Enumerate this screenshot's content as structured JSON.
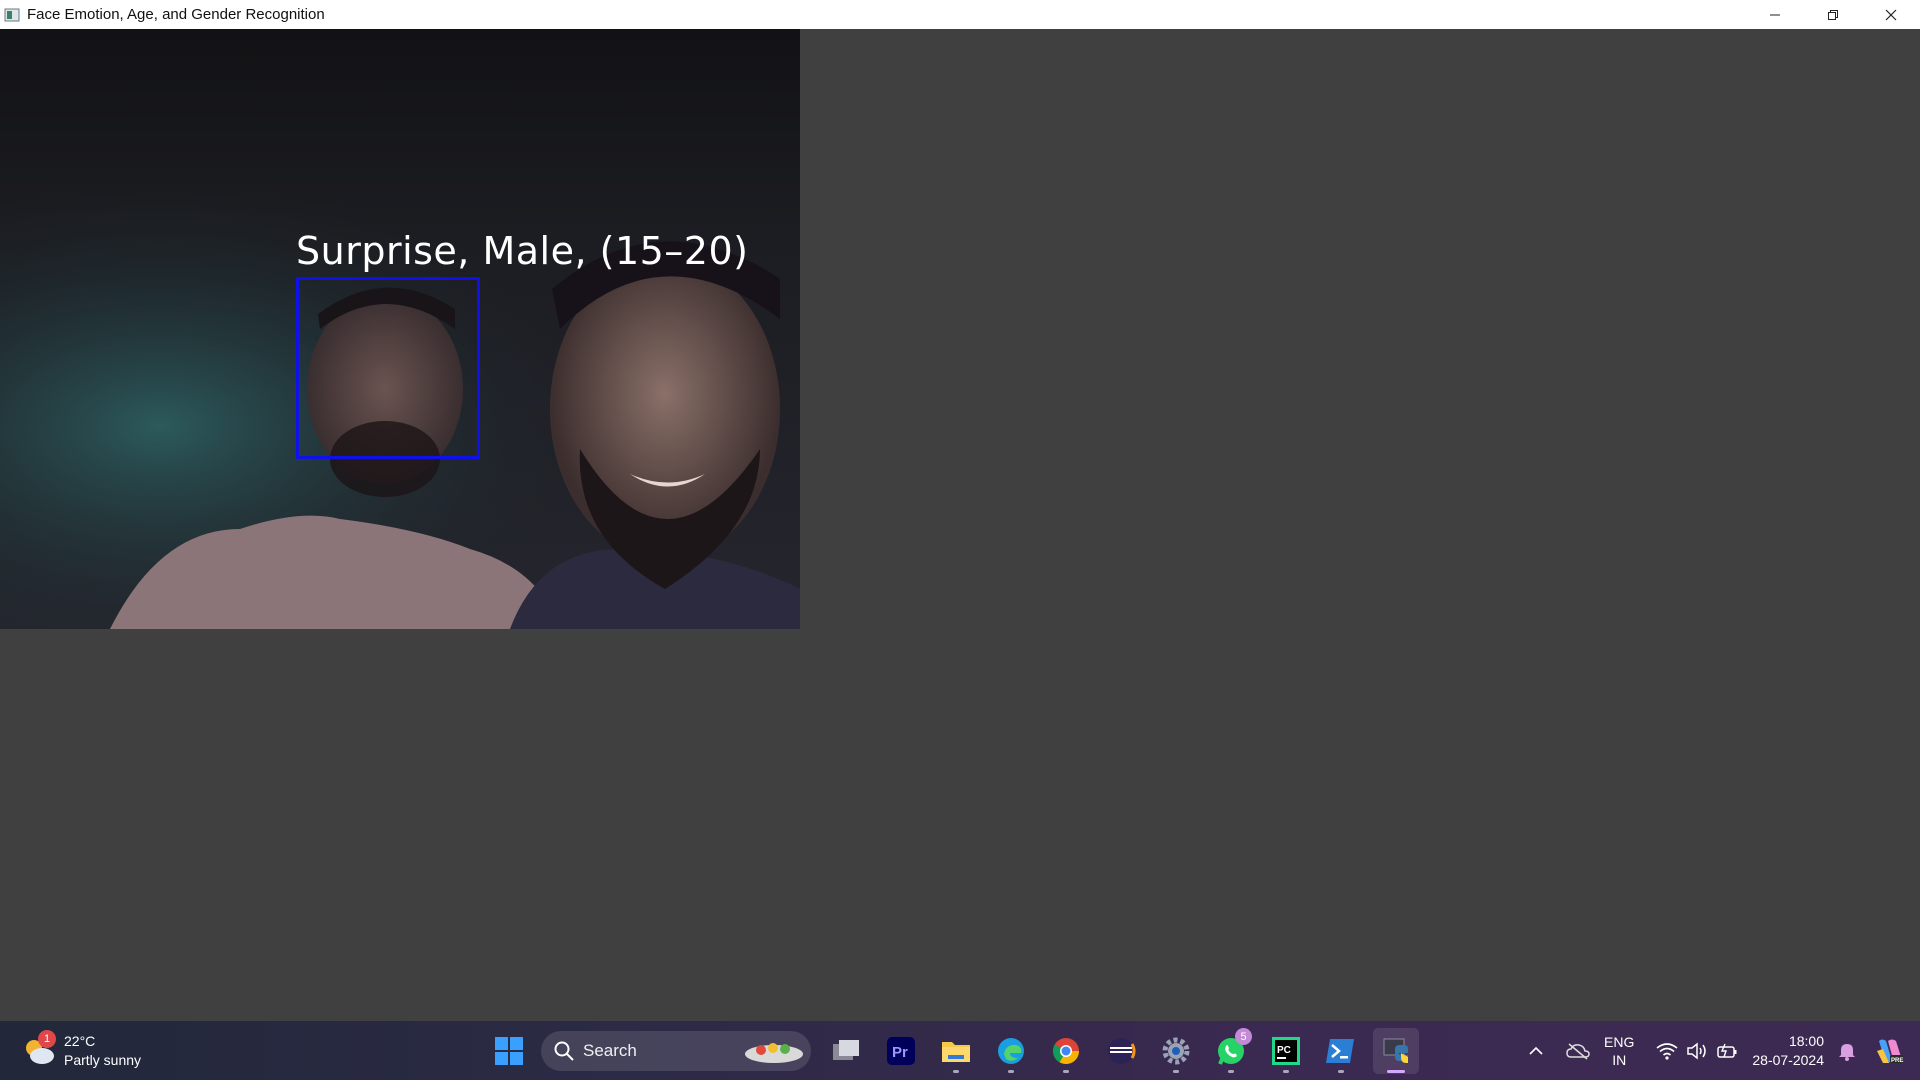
{
  "window": {
    "title": "Face Emotion, Age, and Gender Recognition",
    "controls": [
      "minimize",
      "restore",
      "close"
    ]
  },
  "detection": {
    "label": "Surprise, Male, (15–20)",
    "box_color": "#1010e8"
  },
  "taskbar": {
    "weather": {
      "temp": "22°C",
      "condition": "Partly sunny",
      "badge": "1"
    },
    "search": {
      "label": "Search"
    },
    "apps": [
      {
        "name": "task-view",
        "running": false
      },
      {
        "name": "premiere-pro",
        "running": false
      },
      {
        "name": "file-explorer",
        "running": true
      },
      {
        "name": "edge",
        "running": true
      },
      {
        "name": "chrome",
        "running": true
      },
      {
        "name": "eclipse",
        "running": false
      },
      {
        "name": "settings",
        "running": true
      },
      {
        "name": "whatsapp",
        "running": true,
        "badge": "5"
      },
      {
        "name": "pycharm",
        "running": true
      },
      {
        "name": "terminal",
        "running": true
      },
      {
        "name": "python",
        "running": true,
        "active": true
      }
    ],
    "tray": {
      "lang_line1": "ENG",
      "lang_line2": "IN",
      "time": "18:00",
      "date": "28-07-2024"
    }
  }
}
